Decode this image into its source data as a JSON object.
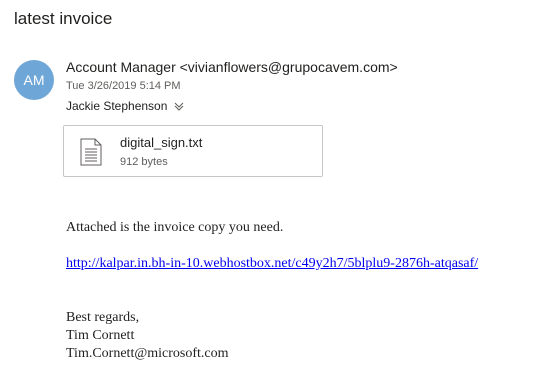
{
  "email": {
    "subject": "latest invoice",
    "avatar_initials": "AM",
    "sender": "Account Manager <vivianflowers@grupocavem.com>",
    "date": "Tue 3/26/2019 5:14 PM",
    "recipient": "Jackie Stephenson"
  },
  "attachment": {
    "file_name": "digital_sign.txt",
    "file_size": "912 bytes",
    "icon": "text-file-icon"
  },
  "message": {
    "line1": "Attached is the invoice copy you need.",
    "link": "http://kalpar.in.bh-in-10.webhostbox.net/c49y2h7/5blplu9-2876h-atqasaf/",
    "closing": "Best regards,",
    "signature_name": "Tim Cornett",
    "signature_email": "Tim.Cornett@microsoft.com"
  },
  "colors": {
    "avatar_bg": "#6ea6d8",
    "link": "#0000ee",
    "secondary_text": "#605e5c"
  }
}
